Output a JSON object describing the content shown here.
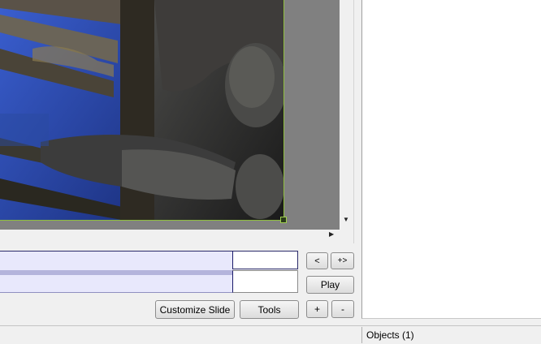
{
  "timeline": {
    "prev_label": "<",
    "next_label": "+>",
    "play_label": "Play"
  },
  "toolbar": {
    "customize_slide_label": "Customize Slide",
    "tools_label": "Tools",
    "add_label": "+",
    "remove_label": "-"
  },
  "status": {
    "objects_label": "Objects (1)"
  },
  "scrollbars": {
    "down_arrow": "▼",
    "right_arrow": "▶"
  },
  "colors": {
    "canvas_background": "#808080",
    "selection_border": "#8fbf3f",
    "timeline_fill": "#e8e8fc",
    "timeline_line": "#2a2a6a"
  },
  "icons": [
    "scroll-down-arrow-icon",
    "scroll-right-arrow-icon",
    "resize-handle-icon"
  ]
}
